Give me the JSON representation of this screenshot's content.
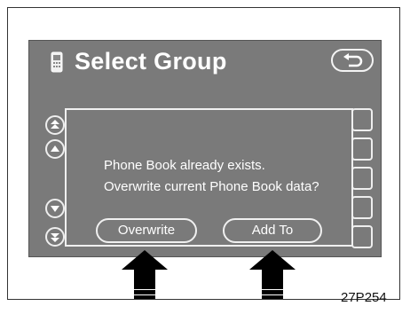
{
  "screen": {
    "title": "Select Group"
  },
  "dialog": {
    "line1": "Phone Book already exists.",
    "line2": "Overwrite current Phone Book data?",
    "overwrite_label": "Overwrite",
    "add_to_label": "Add To"
  },
  "figure_code": "27P254",
  "colors": {
    "screen_bg": "#7a7a7a",
    "text": "#ffffff"
  }
}
